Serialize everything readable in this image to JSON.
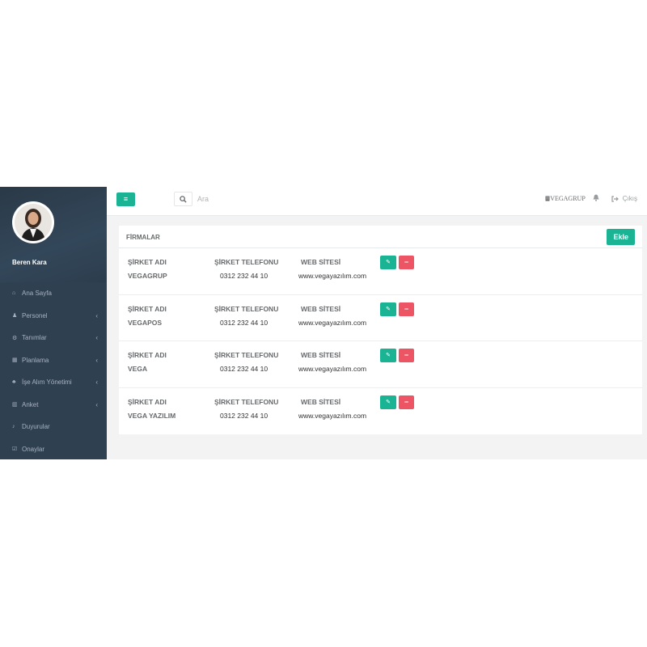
{
  "sidebar": {
    "user_name": "Beren Kara",
    "items": [
      {
        "label": "Ana Sayfa",
        "icon": "home-icon",
        "glyph": "⌂",
        "has_submenu": false
      },
      {
        "label": "Personel",
        "icon": "users-icon",
        "glyph": "♟",
        "has_submenu": true
      },
      {
        "label": "Tanımlar",
        "icon": "gear-icon",
        "glyph": "⚙",
        "has_submenu": true
      },
      {
        "label": "Planlama",
        "icon": "calendar-icon",
        "glyph": "▦",
        "has_submenu": true
      },
      {
        "label": "İşe Alım Yönetimi",
        "icon": "people-group-icon",
        "glyph": "♣",
        "has_submenu": true
      },
      {
        "label": "Anket",
        "icon": "bar-chart-icon",
        "glyph": "▥",
        "has_submenu": true
      },
      {
        "label": "Duyurular",
        "icon": "bell-icon",
        "glyph": "♪",
        "has_submenu": false
      },
      {
        "label": "Onaylar",
        "icon": "check-square-icon",
        "glyph": "☑",
        "has_submenu": false
      }
    ],
    "chevron": "‹"
  },
  "topbar": {
    "menu_glyph": "≡",
    "search_glyph": "⌕",
    "search_placeholder": "Ara",
    "company": "VEGAGRUP",
    "logout": "Çıkış"
  },
  "panel": {
    "title": "FİRMALAR",
    "add_label": "Ekle",
    "headers": {
      "name": "ŞİRKET ADI",
      "phone": "ŞİRKET TELEFONU",
      "web": "WEB SİTESİ"
    },
    "edit_glyph": "✎",
    "delete_glyph": "−",
    "rows": [
      {
        "name": "VEGAGRUP",
        "phone": "0312 232 44 10",
        "web": "www.vegayazılım.com"
      },
      {
        "name": "VEGAPOS",
        "phone": "0312 232 44 10",
        "web": "www.vegayazılım.com"
      },
      {
        "name": "VEGA",
        "phone": "0312 232 44 10",
        "web": "www.vegayazılım.com"
      },
      {
        "name": "VEGA YAZILIM",
        "phone": "0312 232 44 10",
        "web": "www.vegayazılım.com"
      }
    ]
  },
  "colors": {
    "sidebar_bg": "#2f4050",
    "accent": "#1ab394",
    "danger": "#ed5565",
    "page_bg": "#f3f3f4"
  }
}
